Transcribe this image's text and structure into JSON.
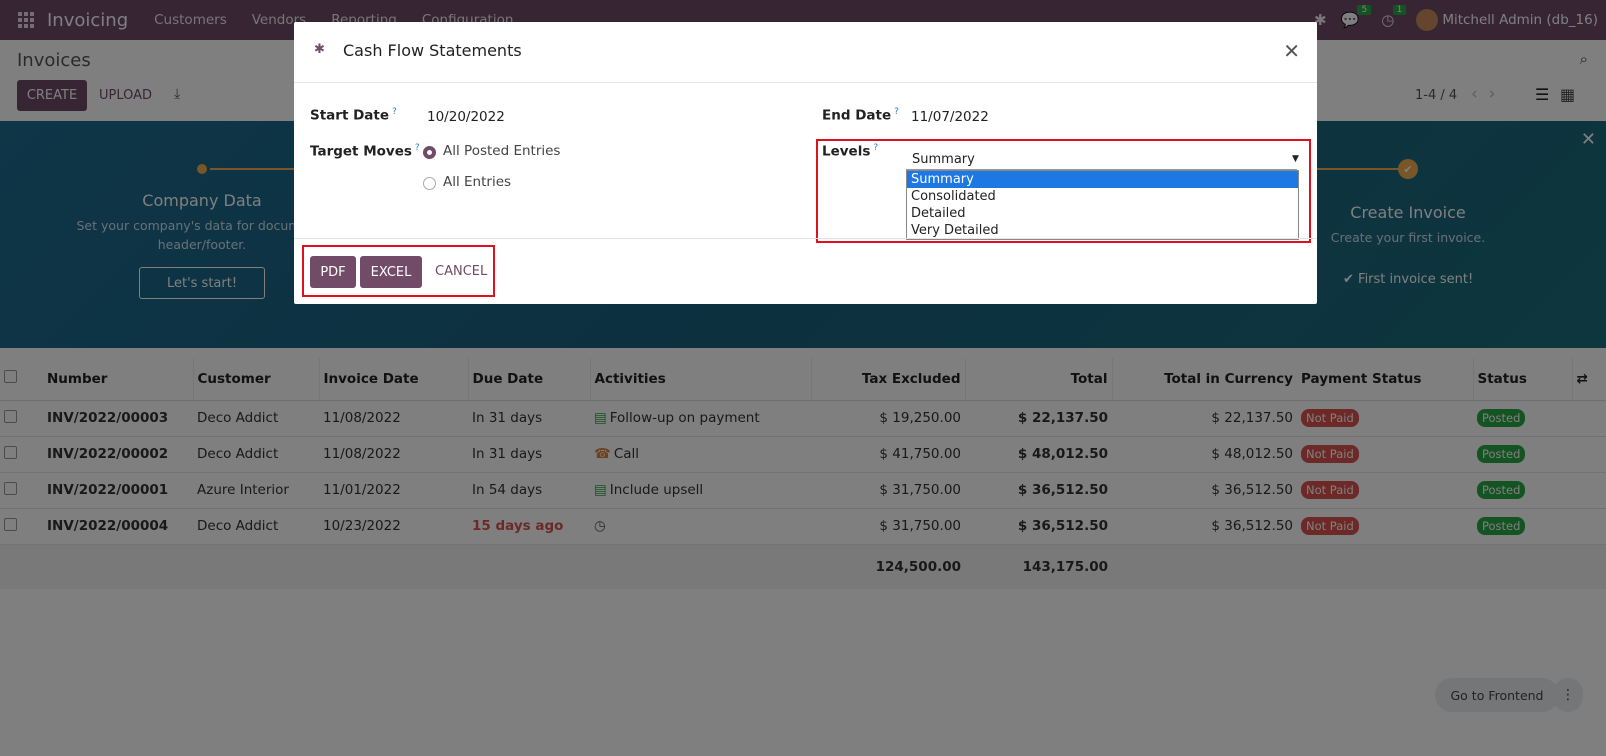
{
  "navbar": {
    "app_name": "Invoicing",
    "menu": [
      "Customers",
      "Vendors",
      "Reporting",
      "Configuration"
    ],
    "messages_count": "5",
    "activities_count": "1",
    "user": "Mitchell Admin (db_16)"
  },
  "control_panel": {
    "breadcrumb": "Invoices",
    "create_label": "CREATE",
    "upload_label": "UPLOAD",
    "pager": "1-4 / 4"
  },
  "banner": {
    "step1_title": "Company Data",
    "step1_text": "Set your company's data for documents header/footer.",
    "step1_button": "Let's start!",
    "step4_title": "Create Invoice",
    "step4_text": "Create your first invoice.",
    "step4_done": "First invoice sent!"
  },
  "table": {
    "headers": [
      "Number",
      "Customer",
      "Invoice Date",
      "Due Date",
      "Activities",
      "Tax Excluded",
      "Total",
      "Total in Currency",
      "Payment Status",
      "Status"
    ],
    "rows": [
      {
        "number": "INV/2022/00003",
        "customer": "Deco Addict",
        "invoice_date": "11/08/2022",
        "due_date": "In 31 days",
        "activity": "Follow-up on payment",
        "tax_excluded": "$ 19,250.00",
        "total": "$ 22,137.50",
        "total_currency": "$ 22,137.50",
        "payment_status": "Not Paid",
        "status": "Posted"
      },
      {
        "number": "INV/2022/00002",
        "customer": "Deco Addict",
        "invoice_date": "11/08/2022",
        "due_date": "In 31 days",
        "activity": "Call",
        "tax_excluded": "$ 41,750.00",
        "total": "$ 48,012.50",
        "total_currency": "$ 48,012.50",
        "payment_status": "Not Paid",
        "status": "Posted"
      },
      {
        "number": "INV/2022/00001",
        "customer": "Azure Interior",
        "invoice_date": "11/01/2022",
        "due_date": "In 54 days",
        "activity": "Include upsell",
        "tax_excluded": "$ 31,750.00",
        "total": "$ 36,512.50",
        "total_currency": "$ 36,512.50",
        "payment_status": "Not Paid",
        "status": "Posted"
      },
      {
        "number": "INV/2022/00004",
        "customer": "Deco Addict",
        "invoice_date": "10/23/2022",
        "due_date": "15 days ago",
        "activity": "",
        "tax_excluded": "$ 31,750.00",
        "total": "$ 36,512.50",
        "total_currency": "$ 36,512.50",
        "payment_status": "Not Paid",
        "status": "Posted"
      }
    ],
    "total_tax_excluded": "124,500.00",
    "total_total": "143,175.00"
  },
  "frontend_label": "Go to Frontend",
  "modal": {
    "title": "Cash Flow Statements",
    "start_date_label": "Start Date",
    "start_date": "10/20/2022",
    "end_date_label": "End Date",
    "end_date": "11/07/2022",
    "target_moves_label": "Target Moves",
    "target_options": [
      "All Posted Entries",
      "All Entries"
    ],
    "levels_label": "Levels",
    "levels_value": "Summary",
    "levels_options": [
      "Summary",
      "Consolidated",
      "Detailed",
      "Very Detailed"
    ],
    "pdf_label": "PDF",
    "excel_label": "EXCEL",
    "cancel_label": "CANCEL",
    "help_mark": "?"
  },
  "colors": {
    "brand": "#714b67",
    "highlight": "#e0101e",
    "selected_option": "#1e78e4"
  }
}
